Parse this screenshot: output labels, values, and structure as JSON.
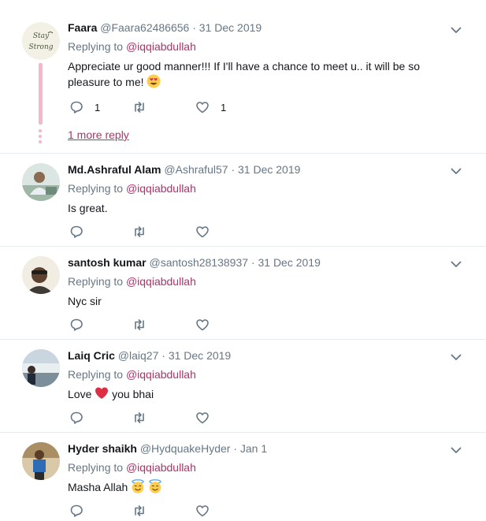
{
  "tweets": [
    {
      "fullname": "Faara",
      "handle": "@Faara62486656",
      "separator": "·",
      "time": "31 Dec 2019",
      "replying_prefix": "Replying to",
      "mention": "@iqqiabdullah",
      "text": "Appreciate ur good manner!!! If I'll have a chance to meet u.. it will be so pleasure to me!",
      "text_emoji": "heart-eyes-emoji",
      "reply_count": "1",
      "like_count": "1",
      "more_reply": "1 more reply"
    },
    {
      "fullname": "Md.Ashraful Alam",
      "handle": "@Ashraful57",
      "separator": "·",
      "time": "31 Dec 2019",
      "replying_prefix": "Replying to",
      "mention": "@iqqiabdullah",
      "text": "Is great."
    },
    {
      "fullname": "santosh kumar",
      "handle": "@santosh28138937",
      "separator": "·",
      "time": "31 Dec 2019",
      "replying_prefix": "Replying to",
      "mention": "@iqqiabdullah",
      "text": "Nyc sir"
    },
    {
      "fullname": "Laiq Cric",
      "handle": "@laiq27",
      "separator": "·",
      "time": "31 Dec 2019",
      "replying_prefix": "Replying to",
      "mention": "@iqqiabdullah",
      "text_before": "Love",
      "text_after": "you bhai",
      "text_emoji": "red-heart-emoji"
    },
    {
      "fullname": "Hyder shaikh",
      "handle": "@HydquakeHyder",
      "separator": "·",
      "time": "Jan 1",
      "replying_prefix": "Replying to",
      "mention": "@iqqiabdullah",
      "text": "Masha Allah",
      "text_emoji": "halo-smile-emoji"
    }
  ],
  "avatar_texts": {
    "faara_line1": "Stay",
    "faara_line2": "Strong"
  },
  "colors": {
    "mention": "#b0306a",
    "secondary_text": "#657786",
    "thread_line": "#f4b8c8",
    "divider": "#e6ecf0"
  },
  "icons": [
    "reply-icon",
    "retweet-icon",
    "like-icon",
    "caret-down-icon"
  ]
}
